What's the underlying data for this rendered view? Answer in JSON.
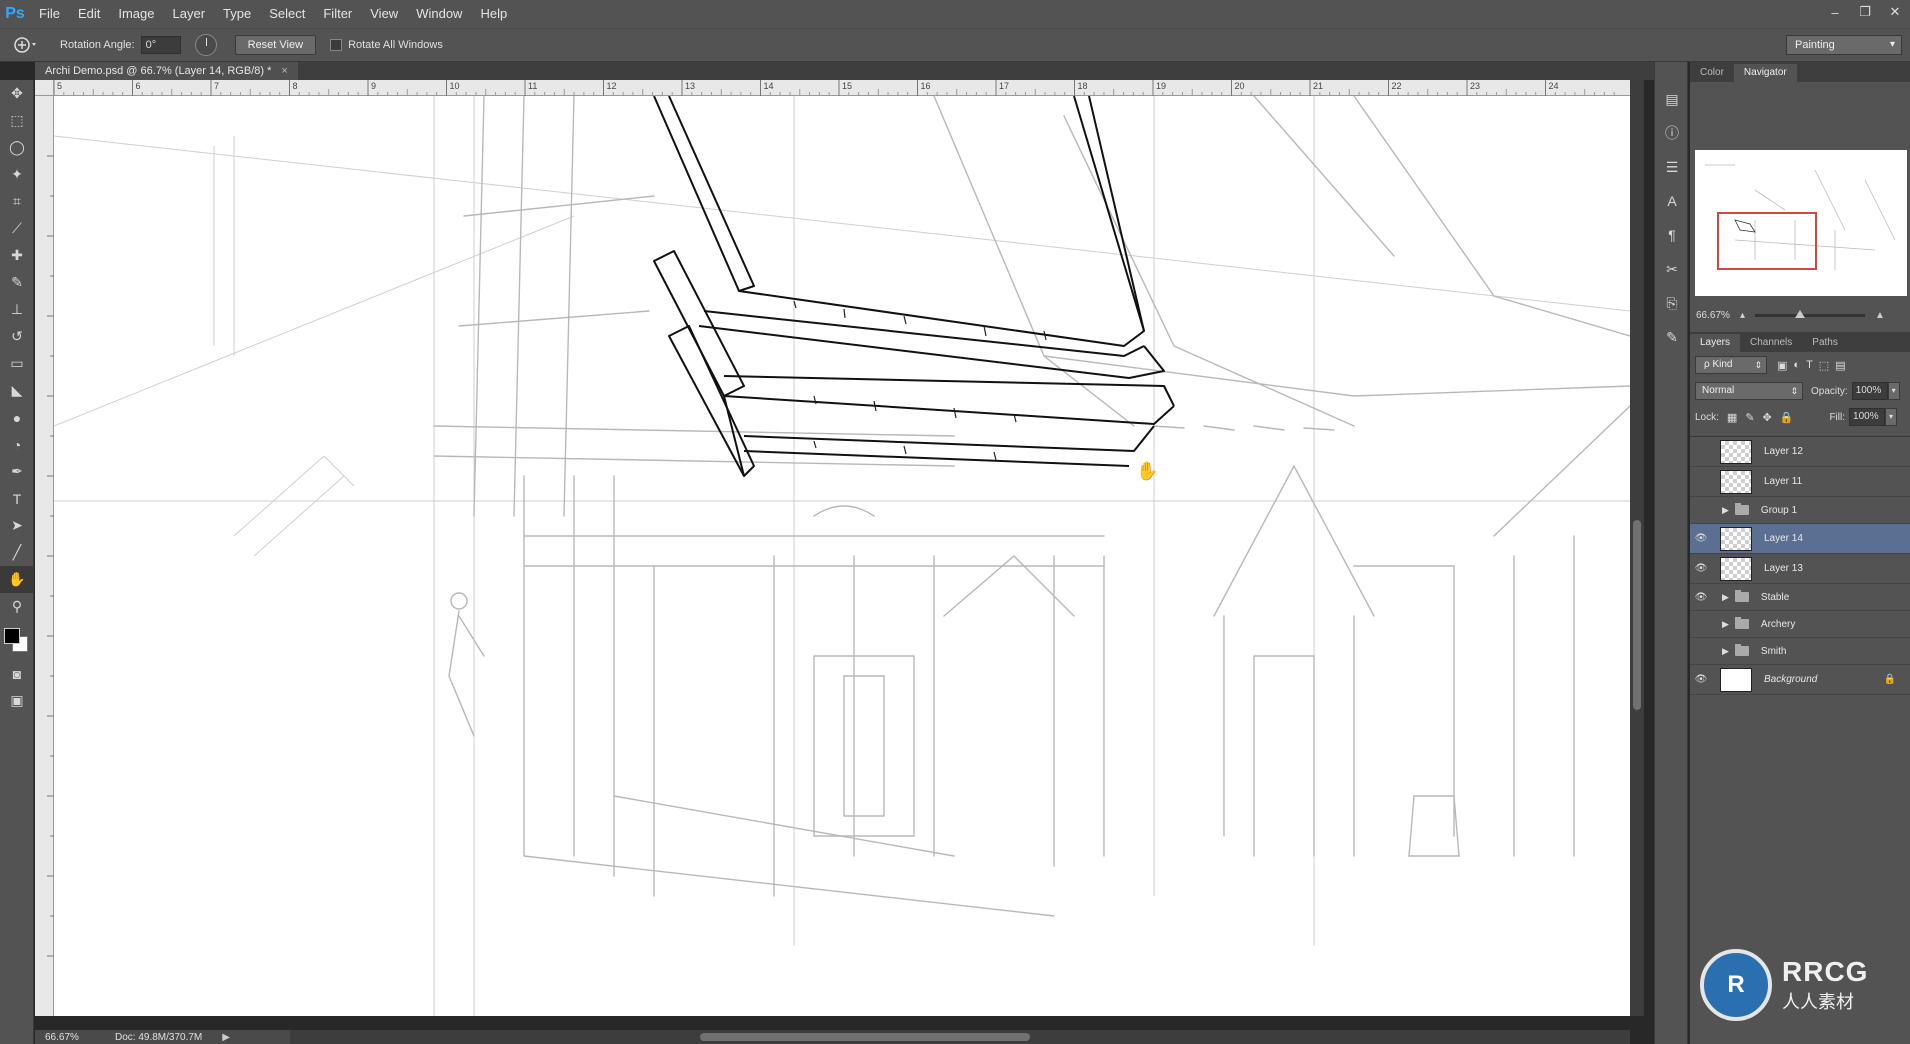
{
  "app": {
    "logo": "Ps"
  },
  "menu": [
    "File",
    "Edit",
    "Image",
    "Layer",
    "Type",
    "Select",
    "Filter",
    "View",
    "Window",
    "Help"
  ],
  "window_controls": [
    "–",
    "❐",
    "✕"
  ],
  "options": {
    "rotation_label": "Rotation Angle:",
    "rotation_value": "0°",
    "reset_view": "Reset View",
    "rotate_all": "Rotate All Windows",
    "workspace": "Painting"
  },
  "document": {
    "tab_title": "Archi Demo.psd @ 66.7% (Layer 14, RGB/8) *",
    "close": "×"
  },
  "ruler_top_numbers": [
    "5",
    "6",
    "7",
    "8",
    "9",
    "10",
    "11",
    "12",
    "13",
    "14",
    "15",
    "16",
    "17",
    "18",
    "19",
    "20",
    "21",
    "22",
    "23",
    "24"
  ],
  "status": {
    "zoom": "66.67%",
    "doc": "Doc: 49.8M/370.7M",
    "arrow": "▶"
  },
  "navigator": {
    "tabs": [
      "Color",
      "Navigator"
    ],
    "active_tab": "Navigator",
    "zoom": "66.67%"
  },
  "layers_panel": {
    "tabs": [
      "Layers",
      "Channels",
      "Paths"
    ],
    "active_tab": "Layers",
    "kind": "ρ Kind",
    "blend_mode": "Normal",
    "opacity_label": "Opacity:",
    "opacity_value": "100%",
    "lock_label": "Lock:",
    "fill_label": "Fill:",
    "fill_value": "100%",
    "layers": [
      {
        "name": "Layer 12",
        "type": "layer",
        "visible": false,
        "selected": false
      },
      {
        "name": "Layer 11",
        "type": "layer",
        "visible": false,
        "selected": false
      },
      {
        "name": "Group 1",
        "type": "group",
        "visible": false,
        "selected": false
      },
      {
        "name": "Layer 14",
        "type": "layer",
        "visible": true,
        "selected": true
      },
      {
        "name": "Layer 13",
        "type": "layer",
        "visible": true,
        "selected": false
      },
      {
        "name": "Stable",
        "type": "group",
        "visible": true,
        "selected": false
      },
      {
        "name": "Archery",
        "type": "group",
        "visible": false,
        "selected": false
      },
      {
        "name": "Smith",
        "type": "group",
        "visible": false,
        "selected": false
      },
      {
        "name": "Background",
        "type": "background",
        "visible": true,
        "selected": false
      }
    ]
  },
  "watermark": {
    "big": "RRCG",
    "small": "人人素材",
    "badge": "R"
  },
  "colors": {
    "accent_selected": "#5a6f91",
    "nav_rect": "#d4463f"
  }
}
